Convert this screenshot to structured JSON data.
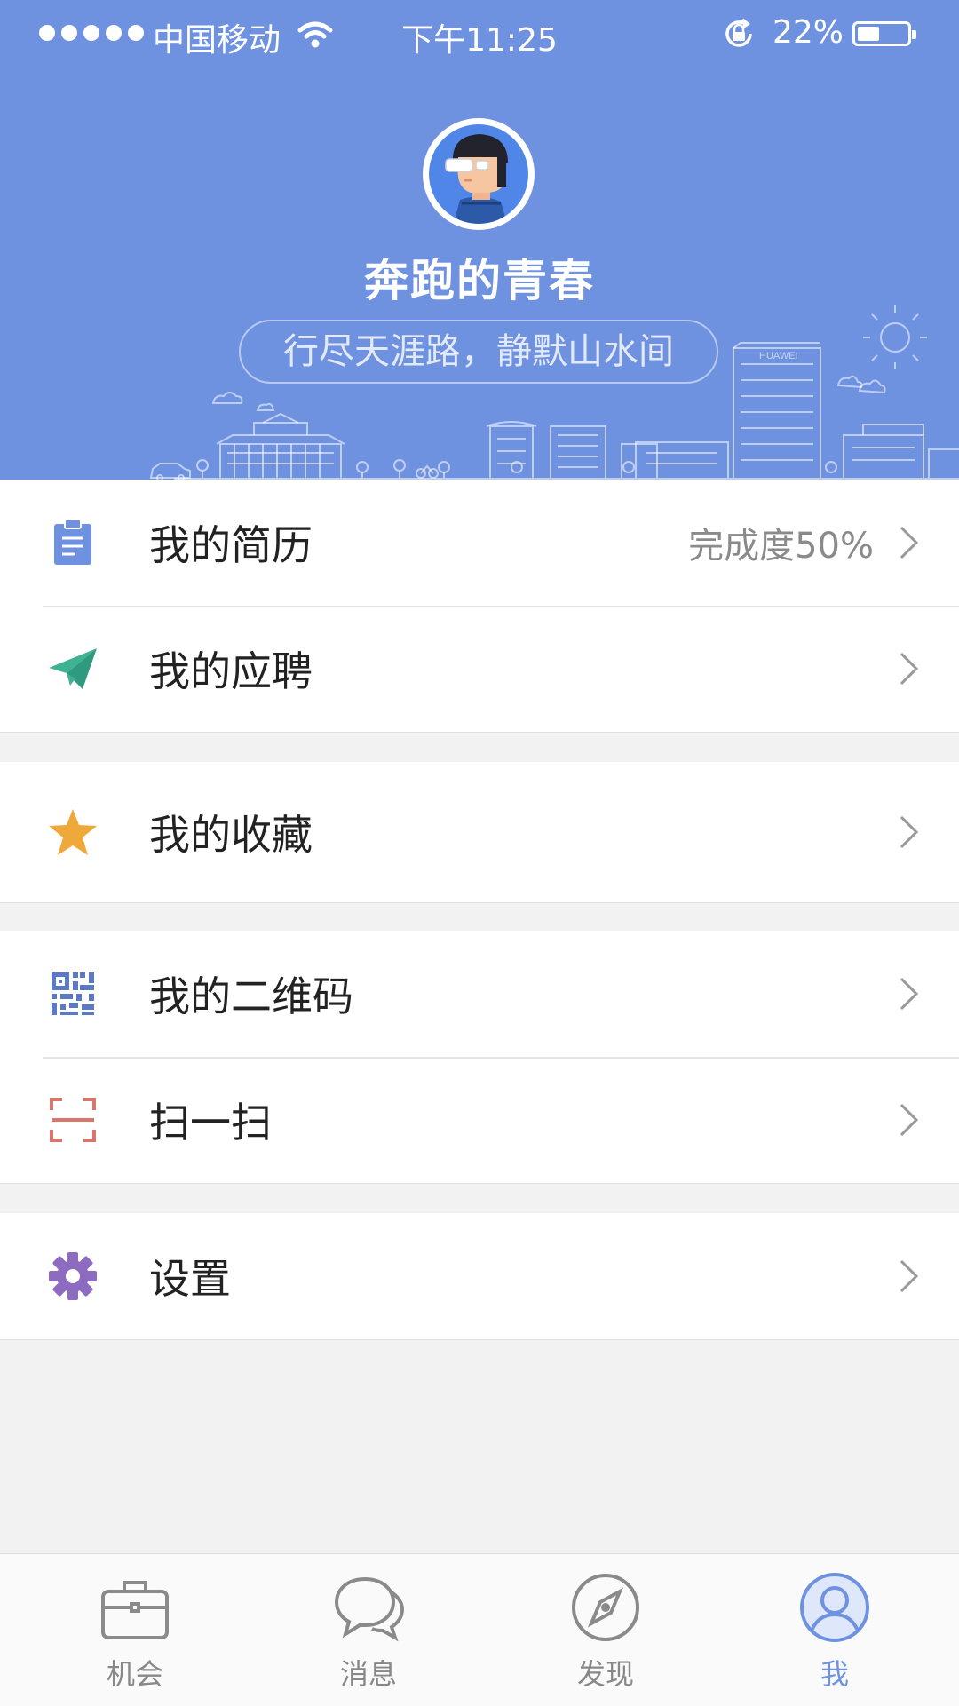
{
  "status_bar": {
    "carrier": "中国移动",
    "time": "下午11:25",
    "battery": "22%",
    "battery_level": 0.22
  },
  "profile": {
    "name": "奔跑的青春",
    "motto": "行尽天涯路，静默山水间",
    "skyline_sign": "HUAWEI"
  },
  "menu": {
    "groups": [
      {
        "items": [
          {
            "label": "我的简历",
            "value": "完成度50%",
            "icon": "clipboard-icon",
            "color": "#6f92e0"
          },
          {
            "label": "我的应聘",
            "icon": "paper-plane-icon",
            "color": "#3fb293"
          }
        ]
      },
      {
        "items": [
          {
            "label": "我的收藏",
            "icon": "star-icon",
            "color": "#efa93a"
          }
        ]
      },
      {
        "items": [
          {
            "label": "我的二维码",
            "icon": "qr-code-icon",
            "color": "#5b79c5"
          },
          {
            "label": "扫一扫",
            "icon": "scan-icon",
            "color": "#d9756a"
          }
        ]
      },
      {
        "items": [
          {
            "label": "设置",
            "icon": "gear-icon",
            "color": "#8c6bc0"
          }
        ]
      }
    ]
  },
  "tabs": [
    {
      "label": "机会",
      "icon": "briefcase-icon",
      "active": false
    },
    {
      "label": "消息",
      "icon": "chat-bubbles-icon",
      "active": false
    },
    {
      "label": "发现",
      "icon": "compass-icon",
      "active": false
    },
    {
      "label": "我",
      "icon": "user-icon",
      "active": true
    }
  ],
  "colors": {
    "header": "#6f92e0",
    "active_tab": "#6f92e0",
    "background": "#f2f2f2"
  }
}
